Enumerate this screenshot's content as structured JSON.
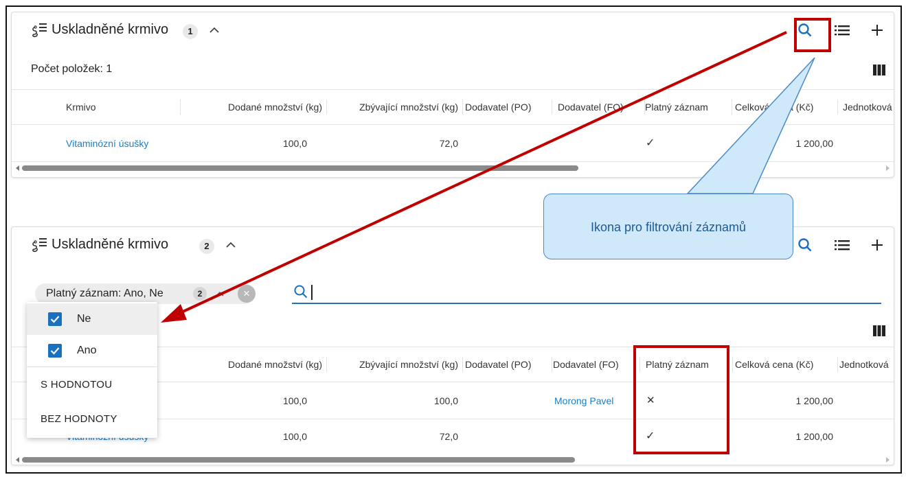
{
  "panels": [
    {
      "title": "Uskladněné krmivo",
      "badge": "1",
      "count_text": "Počet položek: 1",
      "columns": [
        "Krmivo",
        "Dodané množství (kg)",
        "Zbývající množství (kg)",
        "Dodavatel (PO)",
        "Dodavatel (FO)",
        "Platný záznam",
        "Celková cena (Kč)",
        "Jednotková"
      ],
      "rows": [
        {
          "krmivo": "Vitaminózní úsušky",
          "dodane": "100,0",
          "zbyvajici": "72,0",
          "po": "",
          "fo": "",
          "platny": "✓",
          "cena": "1 200,00"
        }
      ]
    },
    {
      "title": "Uskladněné krmivo",
      "badge": "2",
      "columns": [
        "Dodané množství (kg)",
        "Zbývající množství (kg)",
        "Dodavatel (PO)",
        "Dodavatel (FO)",
        "Platný záznam",
        "Celková cena (Kč)",
        "Jednotková"
      ],
      "rows": [
        {
          "krmivo": "",
          "dodane": "100,0",
          "zbyvajici": "100,0",
          "po": "",
          "fo": "Morong Pavel",
          "platny": "✕",
          "cena": "1 200,00"
        },
        {
          "krmivo": "Vitaminózní úsušky",
          "dodane": "100,0",
          "zbyvajici": "72,0",
          "po": "",
          "fo": "",
          "platny": "✓",
          "cena": "1 200,00"
        }
      ]
    }
  ],
  "filter": {
    "chip_text": "Platný záznam: Ano, Ne",
    "chip_count": "2",
    "chip_remove": "×",
    "clear_all": "×",
    "search_value": "",
    "options": [
      {
        "label": "Ne",
        "checked": true
      },
      {
        "label": "Ano",
        "checked": true
      }
    ],
    "extra_options": [
      "S HODNOTOU",
      "BEZ HODNOTY"
    ]
  },
  "callout": {
    "text": "Ikona pro filtrování záznamů"
  },
  "colors": {
    "link": "#1a7fc4",
    "primary": "#1b6fbf",
    "highlight": "#c00000",
    "callout_bg": "#cfe8fa",
    "callout_text": "#1d5a94"
  },
  "icons": [
    "worm-list-icon",
    "chevron-up-icon",
    "search-icon",
    "list-icon",
    "plus-icon",
    "columns-icon",
    "close-icon",
    "clear-circle-icon",
    "checkbox-checked-icon",
    "arrow-left-icon",
    "arrow-right-icon"
  ]
}
